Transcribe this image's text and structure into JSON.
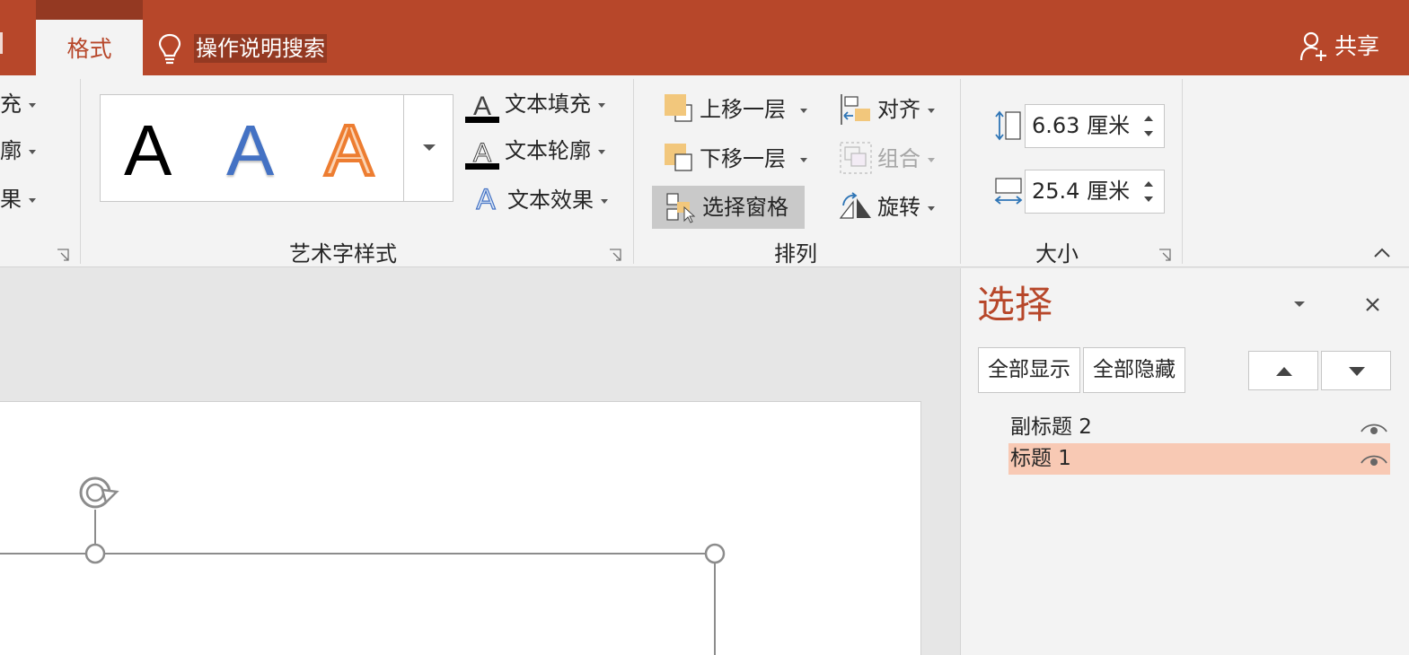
{
  "titlebar": {
    "partial_tab": "",
    "active_tab": "格式",
    "tellme": "操作说明搜索",
    "share": "共享",
    "accent_color": "#b7472a"
  },
  "ribbon": {
    "shape_styles": {
      "fill": "填充",
      "outline": "轮廓",
      "effects": "效果"
    },
    "wordart": {
      "label": "艺术字样式",
      "samples": [
        "A",
        "A",
        "A"
      ],
      "sample_colors": [
        "#000000",
        "#4472c4",
        "#ed7d31"
      ],
      "text_fill": "文本填充",
      "text_outline": "文本轮廓",
      "text_effects": "文本效果"
    },
    "arrange": {
      "label": "排列",
      "bring_forward": "上移一层",
      "send_backward": "下移一层",
      "selection_pane": "选择窗格",
      "align": "对齐",
      "group": "组合",
      "rotate": "旋转"
    },
    "size": {
      "label": "大小",
      "height": "6.63 厘米",
      "width": "25.4 厘米"
    }
  },
  "pane": {
    "title": "选择",
    "show_all": "全部显示",
    "hide_all": "全部隐藏",
    "items": [
      {
        "label": "副标题 2",
        "selected": false
      },
      {
        "label": "标题 1",
        "selected": true
      }
    ]
  }
}
